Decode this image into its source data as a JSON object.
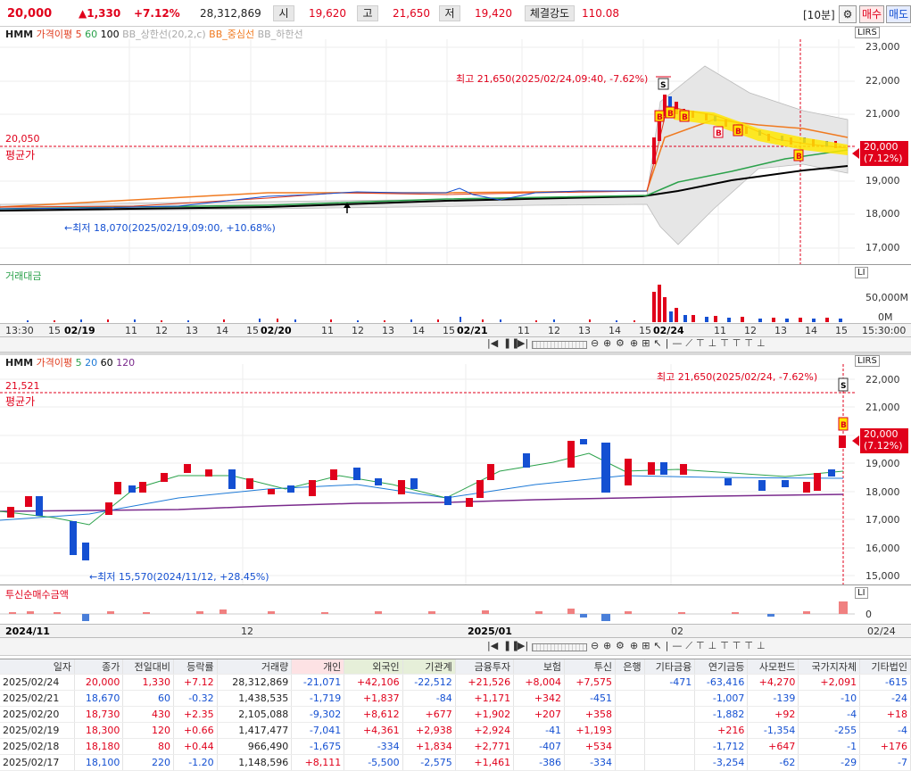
{
  "header": {
    "price": "20,000",
    "change": "▲1,330",
    "change_pct": "+7.12%",
    "volume": "28,312,869",
    "open_label": "시",
    "open_value": "19,620",
    "high_label": "고",
    "high_value": "21,650",
    "low_label": "저",
    "low_value": "19,420",
    "strength_label": "체결강도",
    "strength_value": "110.08",
    "interval": "[10분]",
    "buy_label": "매수",
    "sell_label": "매도",
    "gear_icon": "gear-icon"
  },
  "top_chart": {
    "legend": {
      "symbol": "HMM",
      "ma_label": "가격이평",
      "ma_5": "5",
      "ma_60": "60",
      "ma_100": "100",
      "bb_upper": "BB_상한선(20,2,c)",
      "bb_mid": "BB_중심선",
      "bb_lower": "BB_하한선"
    },
    "high_annotation": "최고 21,650(2025/02/24,09:40, -7.62%)",
    "low_annotation": "←최저 18,070(2025/02/19,09:00, +10.68%)",
    "avg_price_value": "20,050",
    "avg_price_label": "평균가",
    "y_ticks": [
      "23,000",
      "22,000",
      "21,000",
      "20,000",
      "19,000",
      "18,000",
      "17,000"
    ],
    "current_price_tag": "20,000",
    "current_pct_tag": "(7.12%)",
    "toolbar_icons": "LIRS"
  },
  "volume_pane": {
    "title": "거래대금",
    "y_ticks": [
      "50,000M",
      "0M"
    ],
    "toolbar_icons": "LI"
  },
  "top_axis": {
    "ticks": [
      "13:30",
      "15",
      "02/19",
      "11",
      "12",
      "13",
      "14",
      "15",
      "02/20",
      "11",
      "12",
      "13",
      "14",
      "15",
      "02/21",
      "11",
      "12",
      "13",
      "14",
      "15",
      "02/24",
      "11",
      "12",
      "13",
      "14",
      "15"
    ],
    "right_label": "15:30:00"
  },
  "bottom_chart": {
    "legend": {
      "symbol": "HMM",
      "ma_label": "가격이평",
      "ma_5": "5",
      "ma_20": "20",
      "ma_60": "60",
      "ma_120": "120"
    },
    "high_annotation": "최고 21,650(2025/02/24, -7.62%)",
    "low_annotation": "←최저 15,570(2024/11/12, +28.45%)",
    "avg_price_value": "21,521",
    "avg_price_label": "평균가",
    "y_ticks": [
      "22,000",
      "21,000",
      "20,000",
      "19,000",
      "18,000",
      "17,000",
      "16,000",
      "15,000"
    ],
    "current_price_tag": "20,000",
    "current_pct_tag": "(7.12%)",
    "toolbar_icons": "LIRS"
  },
  "invest_pane": {
    "title": "투신순매수금액",
    "y_ticks": [
      "0"
    ],
    "toolbar_icons": "LI"
  },
  "bottom_axis": {
    "ticks": [
      "2024/11",
      "12",
      "2025/01",
      "02"
    ],
    "right_label": "02/24"
  },
  "table": {
    "columns": [
      "일자",
      "종가",
      "전일대비",
      "등락률",
      "거래량",
      "개인",
      "외국인",
      "기관계",
      "금융투자",
      "보험",
      "투신",
      "은행",
      "기타금융",
      "연기금등",
      "사모펀드",
      "국가지자체",
      "기타법인"
    ],
    "rows": [
      [
        "2025/02/24",
        "20,000",
        "1,330",
        "+7.12",
        "28,312,869",
        "-21,071",
        "+42,106",
        "-22,512",
        "+21,526",
        "+8,004",
        "+7,575",
        "",
        "-471",
        "-63,416",
        "+4,270",
        "+2,091",
        "-615"
      ],
      [
        "2025/02/21",
        "18,670",
        "60",
        "-0.32",
        "1,438,535",
        "-1,719",
        "+1,837",
        "-84",
        "+1,171",
        "+342",
        "-451",
        "",
        "",
        "-1,007",
        "-139",
        "-10",
        "-24"
      ],
      [
        "2025/02/20",
        "18,730",
        "430",
        "+2.35",
        "2,105,088",
        "-9,302",
        "+8,612",
        "+677",
        "+1,902",
        "+207",
        "+358",
        "",
        "",
        "-1,882",
        "+92",
        "-4",
        "+18"
      ],
      [
        "2025/02/19",
        "18,300",
        "120",
        "+0.66",
        "1,417,477",
        "-7,041",
        "+4,361",
        "+2,938",
        "+2,924",
        "-41",
        "+1,193",
        "",
        "",
        "+216",
        "-1,354",
        "-255",
        "-4"
      ],
      [
        "2025/02/18",
        "18,180",
        "80",
        "+0.44",
        "966,490",
        "-1,675",
        "-334",
        "+1,834",
        "+2,771",
        "-407",
        "+534",
        "",
        "",
        "-1,712",
        "+647",
        "-1",
        "+176"
      ],
      [
        "2025/02/17",
        "18,100",
        "220",
        "-1.20",
        "1,148,596",
        "+8,111",
        "-5,500",
        "-2,575",
        "+1,461",
        "-386",
        "-334",
        "",
        "",
        "-3,254",
        "-62",
        "-29",
        "-7"
      ]
    ]
  },
  "colors": {
    "up": "#e0001b",
    "down": "#1450d2",
    "ma5": "#e03c1e",
    "ma20": "#1e7ad7",
    "ma60": "#2aa14a",
    "ma100": "#000000",
    "ma120": "#7a2a8c",
    "bb_band": "#e6e6e6",
    "signal": "#ffe600"
  }
}
